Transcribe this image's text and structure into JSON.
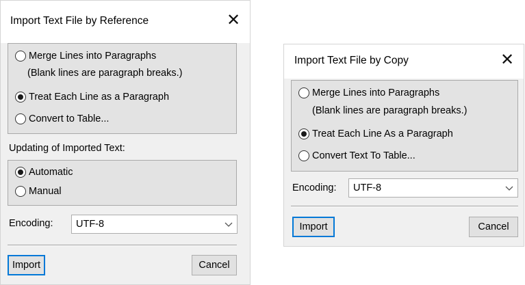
{
  "dialog_reference": {
    "title": "Import Text File by Reference",
    "close_glyph": "✕",
    "options": [
      {
        "label": "Merge Lines into Paragraphs",
        "checked": false
      },
      {
        "label": "Treat Each Line as a Paragraph",
        "checked": true
      },
      {
        "label": "Convert to Table...",
        "checked": false
      }
    ],
    "merge_note": "(Blank lines are paragraph breaks.)",
    "updating_label": "Updating of Imported Text:",
    "updating_options": [
      {
        "label": "Automatic",
        "checked": true
      },
      {
        "label": "Manual",
        "checked": false
      }
    ],
    "encoding_label": "Encoding:",
    "encoding_value": "UTF-8",
    "import_label": "Import",
    "cancel_label": "Cancel"
  },
  "dialog_copy": {
    "title": "Import Text File by Copy",
    "close_glyph": "✕",
    "options": [
      {
        "label": "Merge Lines into Paragraphs",
        "checked": false
      },
      {
        "label": "Treat Each Line As a Paragraph",
        "checked": true
      },
      {
        "label": "Convert Text To Table...",
        "checked": false
      }
    ],
    "merge_note": "(Blank lines are paragraph breaks.)",
    "encoding_label": "Encoding:",
    "encoding_value": "UTF-8",
    "import_label": "Import",
    "cancel_label": "Cancel"
  },
  "icons": {
    "radio": "radio-button-icon",
    "dropdown": "chevron-down-icon",
    "close": "close-icon"
  }
}
